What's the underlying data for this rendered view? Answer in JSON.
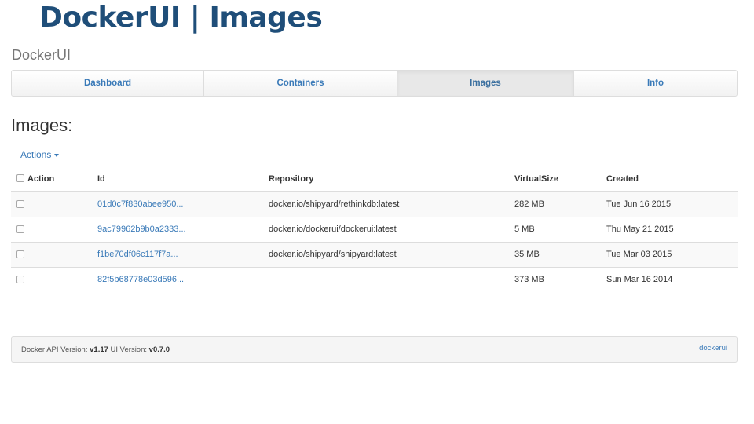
{
  "slide_title": "DockerUI | Images",
  "brand": "DockerUI",
  "nav": {
    "items": [
      {
        "label": "Dashboard"
      },
      {
        "label": "Containers"
      },
      {
        "label": "Images",
        "active": true
      },
      {
        "label": "Info"
      }
    ]
  },
  "page_heading": "Images:",
  "actions_label": "Actions",
  "table": {
    "headers": {
      "action": "Action",
      "id": "Id",
      "repository": "Repository",
      "virtual_size": "VirtualSize",
      "created": "Created"
    },
    "rows": [
      {
        "id": "01d0c7f830abee950...",
        "repository": "docker.io/shipyard/rethinkdb:latest",
        "virtual_size": "282 MB",
        "created": "Tue Jun 16 2015"
      },
      {
        "id": "9ac79962b9b0a2333...",
        "repository": "docker.io/dockerui/dockerui:latest",
        "virtual_size": "5 MB",
        "created": "Thu May 21 2015"
      },
      {
        "id": "f1be70df06c117f7a...",
        "repository": "docker.io/shipyard/shipyard:latest",
        "virtual_size": "35 MB",
        "created": "Tue Mar 03 2015"
      },
      {
        "id": "82f5b68778e03d596...",
        "repository": "",
        "virtual_size": "373 MB",
        "created": "Sun Mar 16 2014"
      }
    ]
  },
  "footer": {
    "api_label": "Docker API Version:",
    "api_version": "v1.17",
    "ui_label": "UI Version:",
    "ui_version": "v0.7.0",
    "link": "dockerui"
  },
  "colors": {
    "title": "#1f4e79",
    "link": "#3a7ab8"
  }
}
